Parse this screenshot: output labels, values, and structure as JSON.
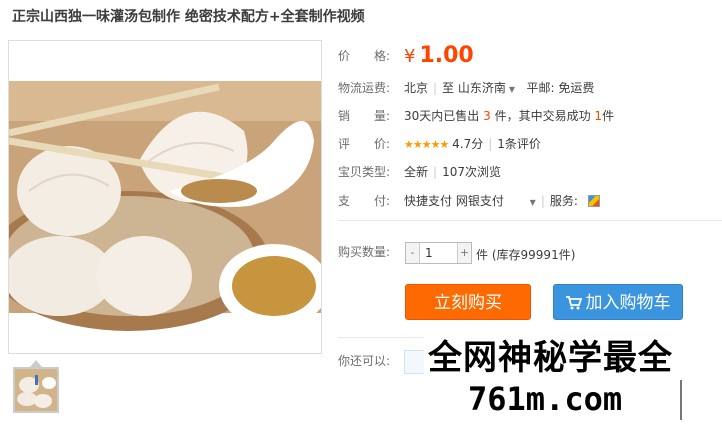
{
  "product": {
    "title": "正宗山西独一味灌汤包制作 绝密技术配方+全套制作视频"
  },
  "price": {
    "label": "价　　格:",
    "currency": "¥",
    "value": "1.00"
  },
  "shipping": {
    "label": "物流运费:",
    "from": "北京",
    "to_prefix": "至",
    "to": "山东济南",
    "method": "平邮: 免运费"
  },
  "sales": {
    "label": "销　　量:",
    "prefix": "30天内已售出",
    "sold": "3",
    "mid": "件，其中交易成功",
    "success": "1",
    "suffix": "件"
  },
  "rating": {
    "label": "评　　价:",
    "stars": "★★★★★",
    "score": "4.7分",
    "reviews": "1条评价"
  },
  "item_type": {
    "label": "宝贝类型:",
    "condition": "全新",
    "views": "107次浏览"
  },
  "payment": {
    "label": "支　　付:",
    "methods": "快捷支付  网银支付",
    "service_label": "服务:"
  },
  "quantity": {
    "label": "购买数量:",
    "minus": "-",
    "value": "1",
    "plus": "+",
    "unit": "件",
    "stock": "(库存99991件)"
  },
  "buttons": {
    "buy_now": "立刻购买",
    "add_to_cart": "加入购物车"
  },
  "share": {
    "label": "你还可以:"
  },
  "watermark": {
    "line1": "全网神秘学最全",
    "line2": "761m.com"
  },
  "colors": {
    "price": "#ff4400",
    "buy_button": "#ff6a00",
    "cart_button": "#3a95de",
    "stars": "#ff9900"
  }
}
